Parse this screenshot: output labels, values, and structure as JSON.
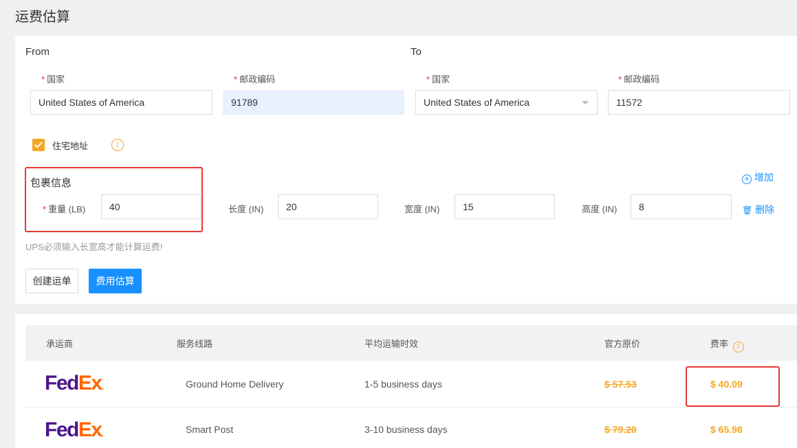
{
  "page": {
    "title": "运费估算"
  },
  "from": {
    "label": "From",
    "country_label": "国家",
    "country_value": "United States of America",
    "zip_label": "邮政编码",
    "zip_value": "91789"
  },
  "to": {
    "label": "To",
    "country_label": "国家",
    "country_value": "United States of America",
    "zip_label": "邮政编码",
    "zip_value": "11572"
  },
  "residential": {
    "label": "住宅地址",
    "checked": true
  },
  "package": {
    "title": "包裹信息",
    "weight_label": "重量 (LB)",
    "weight_value": "40",
    "length_label": "长度 (IN)",
    "length_value": "20",
    "width_label": "宽度 (IN)",
    "width_value": "15",
    "height_label": "高度 (IN)",
    "height_value": "8",
    "add_label": "增加",
    "delete_label": "删除",
    "hint": "UPS必须输入长宽高才能计算运费!"
  },
  "actions": {
    "create_label": "创建运单",
    "estimate_label": "费用估算"
  },
  "table": {
    "headers": {
      "carrier": "承运商",
      "service": "服务线路",
      "transit": "平均运输时效",
      "official": "官方原价",
      "rate": "费率"
    },
    "rows": [
      {
        "carrier_fed": "Fed",
        "carrier_ex": "Ex",
        "carrier_dot": ".",
        "service": "Ground Home Delivery",
        "transit": "1-5 business days",
        "official": "$ 57.53",
        "rate": "$ 40.09"
      },
      {
        "carrier_fed": "Fed",
        "carrier_ex": "Ex",
        "carrier_dot": ".",
        "service": "Smart Post",
        "transit": "3-10 business days",
        "official": "$ 79.20",
        "rate": "$ 65.98"
      }
    ]
  },
  "colors": {
    "accent": "#1890ff",
    "warning": "#f5a623",
    "highlight": "#e53935",
    "fedex_purple": "#4d148c",
    "fedex_orange": "#ff6600"
  }
}
